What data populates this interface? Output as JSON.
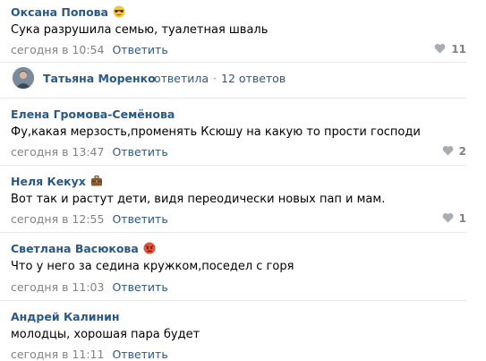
{
  "comments": [
    {
      "author": "Оксана Попова",
      "emoji": "sunglasses-emoji",
      "text": "Сука разрушила семью, туалетная шваль",
      "time": "сегодня в 10:54",
      "reply": "Ответить",
      "likes": "11"
    },
    {
      "author": "Елена Громова-Семёнова",
      "emoji": "",
      "text": "Фу,какая мерзость,променять Ксюшу на какую то прости господи",
      "time": "сегодня в 13:47",
      "reply": "Ответить",
      "likes": "2"
    },
    {
      "author": "Неля Кекух",
      "emoji": "briefcase-emoji",
      "text": "Вот так и растут дети, видя переодически новых пап и мам.",
      "time": "сегодня в 12:55",
      "reply": "Ответить",
      "likes": "1"
    },
    {
      "author": "Светлана Васюкова",
      "emoji": "angry-face-emoji",
      "text": "Что у него за седина кружком,поседел с горя",
      "time": "сегодня в 11:03",
      "reply": "Ответить",
      "likes": ""
    },
    {
      "author": "Андрей Калинин",
      "emoji": "",
      "text": "молодцы, хорошая пара будет",
      "time": "сегодня в 11:11",
      "reply": "Ответить",
      "likes": ""
    }
  ],
  "thread": {
    "name": "Татьяна Моренко",
    "action": "ответила",
    "separator": "·",
    "count": "12 ответов"
  },
  "colors": {
    "link": "#2a5885",
    "meta": "#828282",
    "divider": "#e7e8ec"
  }
}
